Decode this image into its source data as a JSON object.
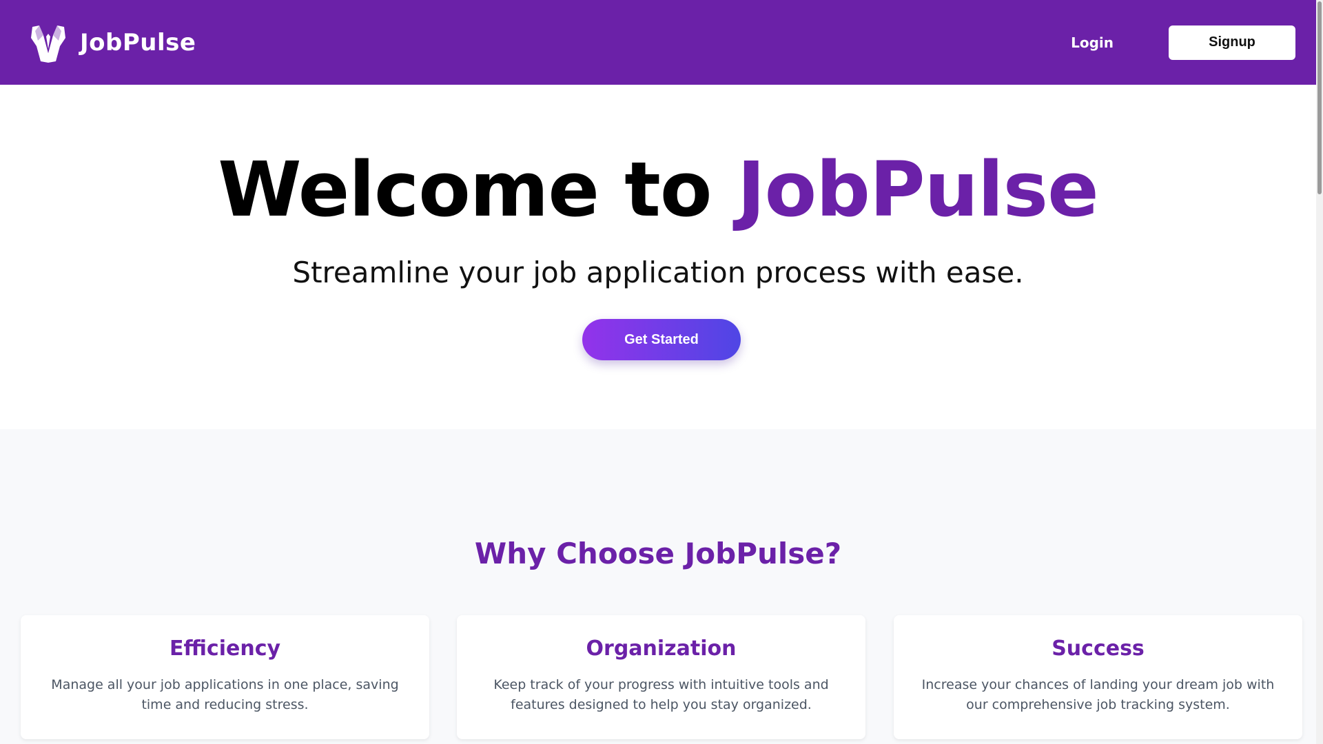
{
  "navbar": {
    "brand_name": "JobPulse",
    "logo_icon": "tuxedo-logo-icon",
    "login_label": "Login",
    "signup_label": "Signup"
  },
  "hero": {
    "title_prefix": "Welcome to ",
    "title_accent": "JobPulse",
    "subtitle": "Streamline your job application process with ease.",
    "cta_label": "Get Started"
  },
  "features": {
    "heading": "Why Choose JobPulse?",
    "cards": [
      {
        "title": "Efficiency",
        "description": "Manage all your job applications in one place, saving time and reducing stress."
      },
      {
        "title": "Organization",
        "description": "Keep track of your progress with intuitive tools and features designed to help you stay organized."
      },
      {
        "title": "Success",
        "description": "Increase your chances of landing your dream job with our comprehensive job tracking system."
      }
    ]
  },
  "colors": {
    "brand_purple": "#6b21a8",
    "cta_gradient_start": "#9333ea",
    "cta_gradient_end": "#4f46e5",
    "section_bg": "#f8f9fb"
  }
}
